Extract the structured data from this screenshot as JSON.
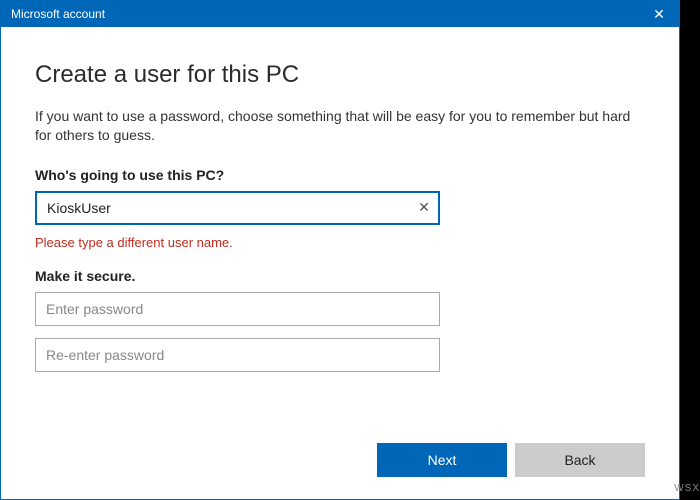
{
  "window": {
    "title": "Microsoft account",
    "close_icon": "✕"
  },
  "main": {
    "heading": "Create a user for this PC",
    "description": "If you want to use a password, choose something that will be easy for you to remember but hard for others to guess.",
    "username_label": "Who's going to use this PC?",
    "username_value": "KioskUser",
    "clear_icon": "✕",
    "error_text": "Please type a different user name.",
    "secure_label": "Make it secure.",
    "password_placeholder": "Enter password",
    "reenter_placeholder": "Re-enter password"
  },
  "footer": {
    "next_label": "Next",
    "back_label": "Back"
  },
  "watermark": "WSX"
}
